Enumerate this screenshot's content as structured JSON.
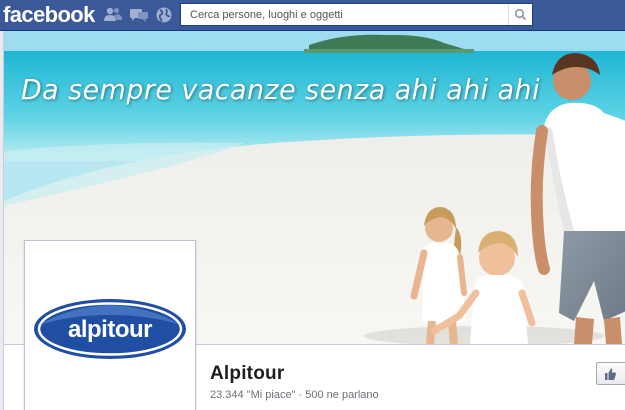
{
  "topbar": {
    "logo": "facebook",
    "jewels": [
      "friend-requests-icon",
      "messages-icon",
      "notifications-globe-icon"
    ],
    "search": {
      "placeholder": "Cerca persone, luoghi e oggetti",
      "value": ""
    },
    "colors": {
      "bar": "#3b5998",
      "border": "#133783"
    }
  },
  "cover": {
    "slogan": "Da sempre vacanze senza ahi ahi ahi",
    "colors": {
      "sky": "#8ed4ec",
      "sea": "#2bbfd8",
      "sand": "#f4f2ee"
    }
  },
  "profile": {
    "logo_text": "alpitour",
    "colors": {
      "logo_blue": "#1f4ea3"
    }
  },
  "page": {
    "name": "Alpitour",
    "stats": "23.344 \"Mi piace\" · 500 ne parlano"
  },
  "actions": {
    "like_icon": "thumbs-up-icon"
  }
}
